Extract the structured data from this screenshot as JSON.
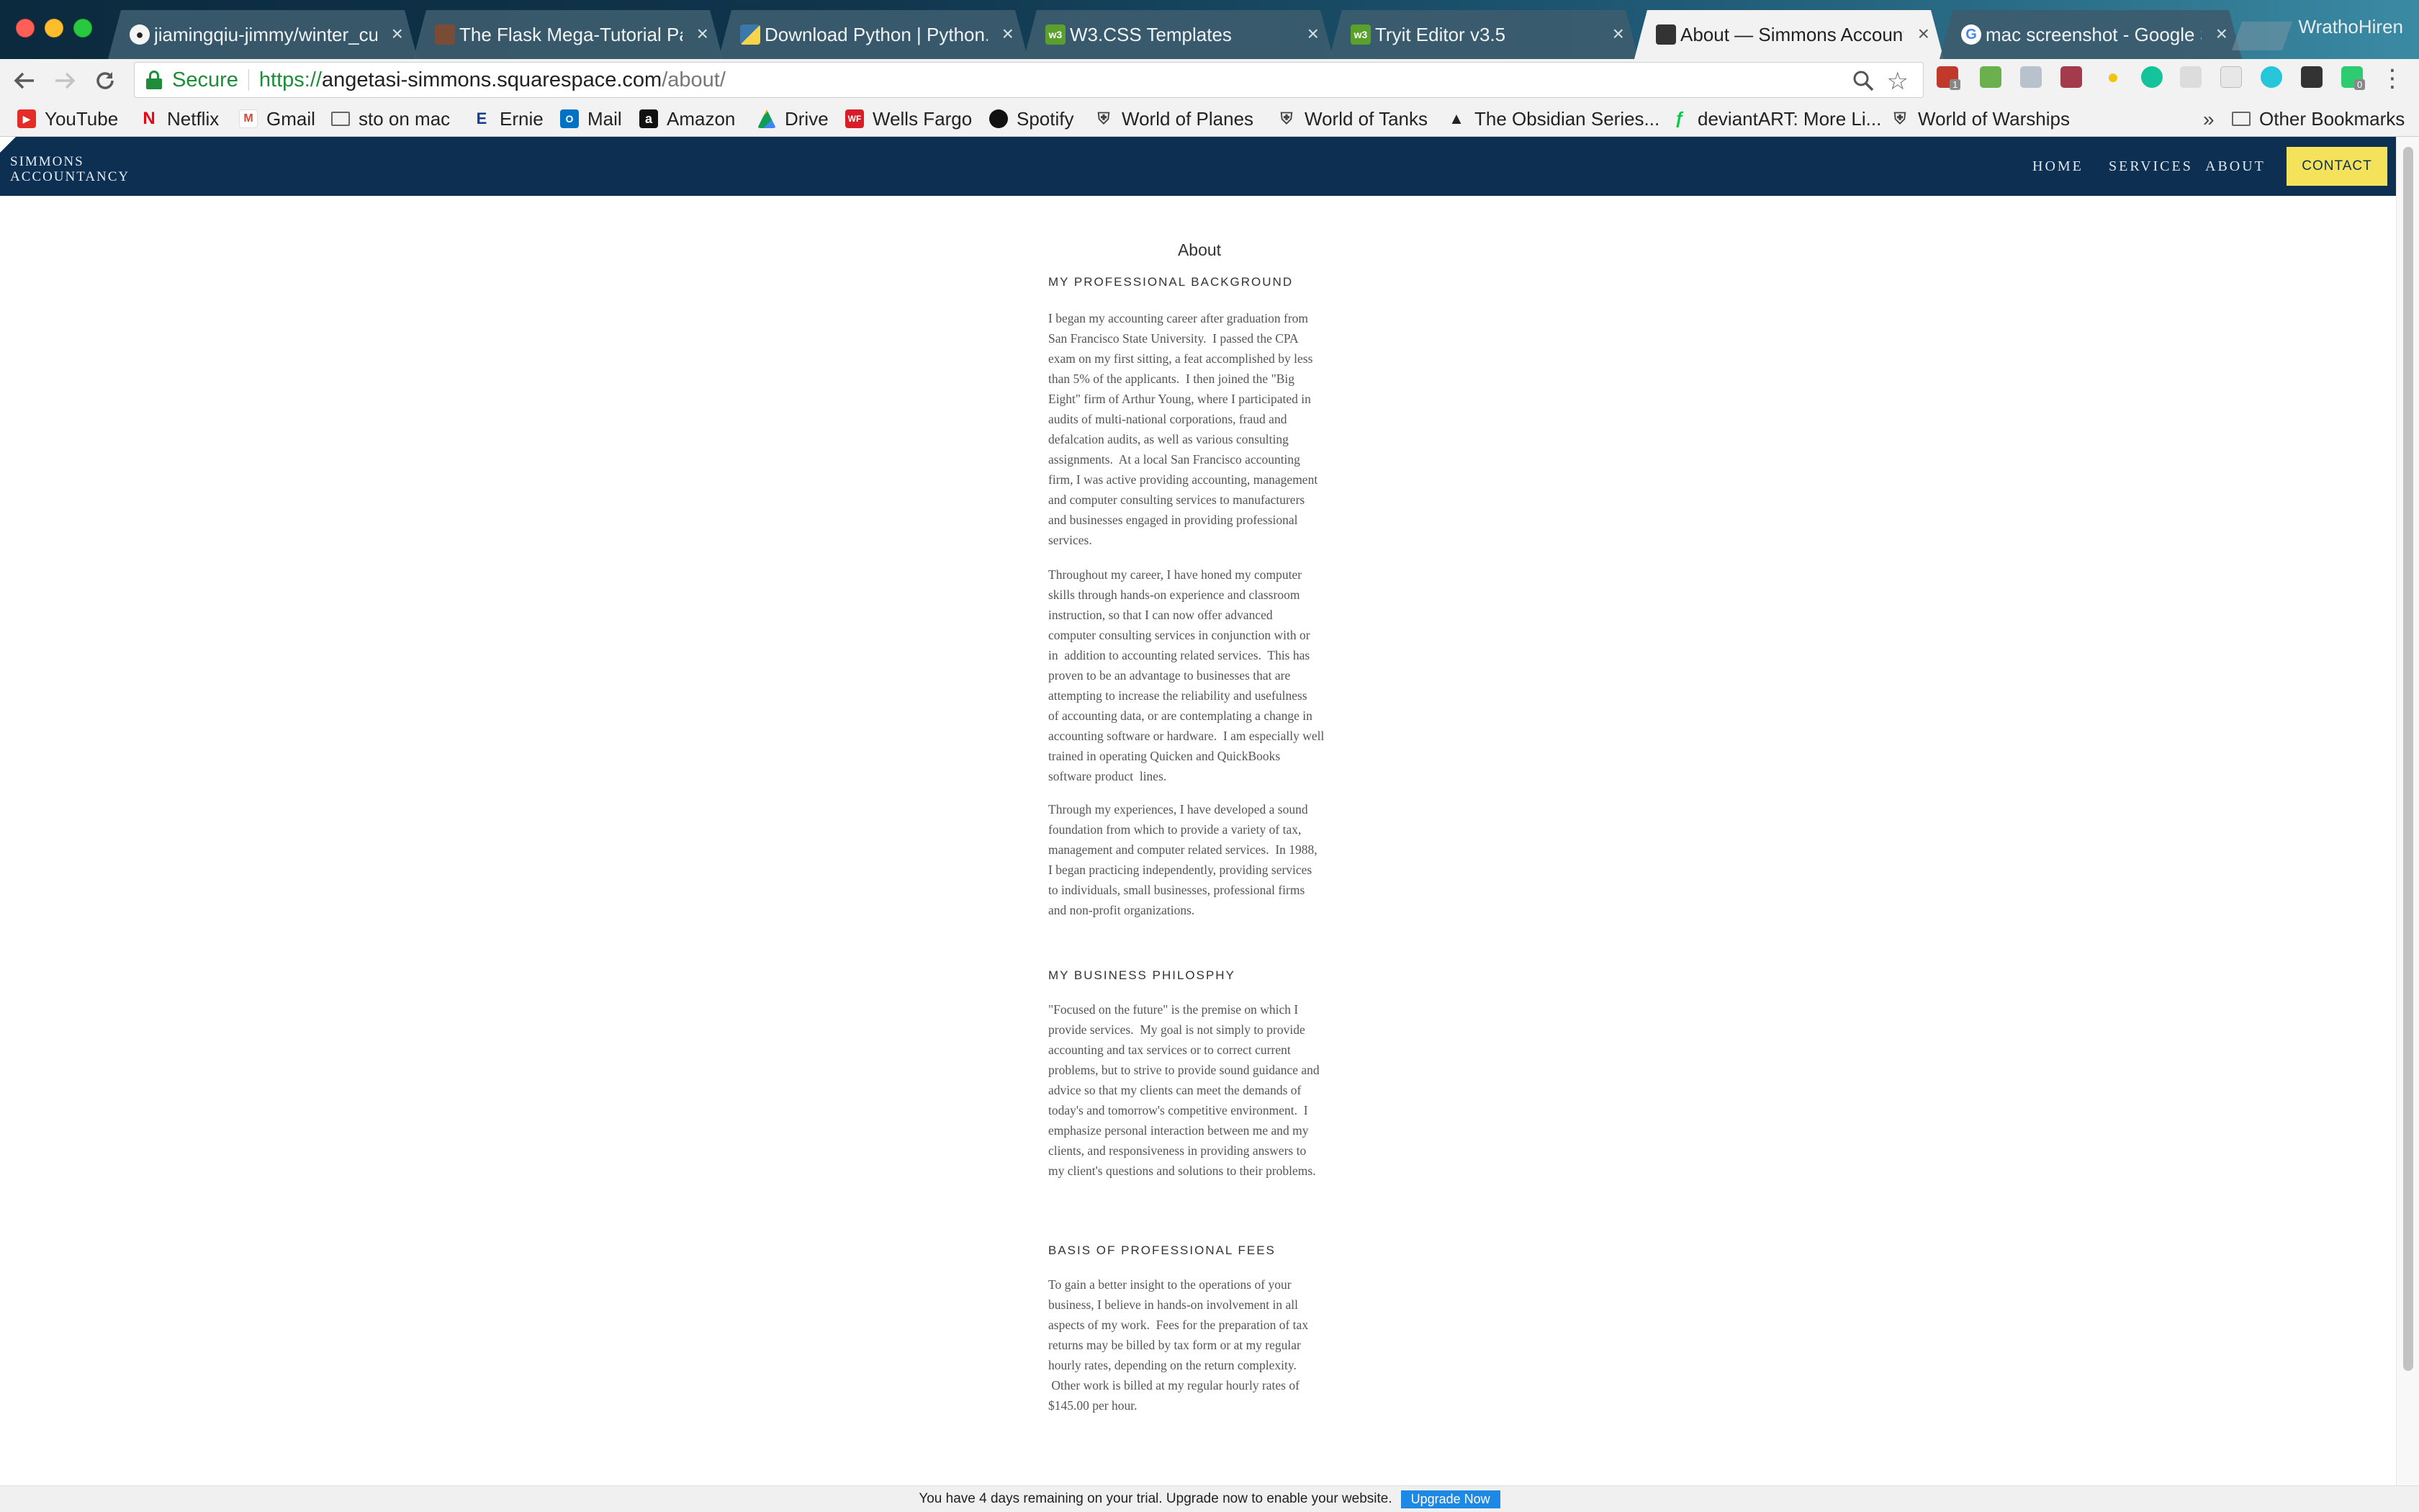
{
  "browser": {
    "tabs": [
      {
        "title": "jiamingqiu-jimmy/winter_cu",
        "favicon": "github-icon",
        "active": false
      },
      {
        "title": "The Flask Mega-Tutorial Pa",
        "favicon": "avatar-photo-icon",
        "active": false
      },
      {
        "title": "Download Python | Python.",
        "favicon": "python-logo-icon",
        "active": false
      },
      {
        "title": "W3.CSS Templates",
        "favicon": "w3schools-icon",
        "active": false
      },
      {
        "title": "Tryit Editor v3.5",
        "favicon": "w3schools-icon",
        "active": false
      },
      {
        "title": "About — Simmons Account",
        "favicon": "squarespace-cube-icon",
        "active": true
      },
      {
        "title": "mac screenshot - Google S",
        "favicon": "google-g-icon",
        "active": false
      }
    ],
    "tab_close_glyph": "×",
    "profile_name": "WrathoHiren",
    "secure_label": "Secure",
    "url": {
      "scheme": "https://",
      "host": "angetasi-simmons.squarespace.com",
      "path": "/about/"
    },
    "extension_badges": {
      "first": "1",
      "last": "0"
    },
    "bookmarks": [
      {
        "label": "YouTube",
        "icon": "youtube-icon"
      },
      {
        "label": "Netflix",
        "icon": "netflix-icon"
      },
      {
        "label": "Gmail",
        "icon": "gmail-icon"
      },
      {
        "label": "sto on mac",
        "icon": "folder-icon"
      },
      {
        "label": "Ernie",
        "icon": "e-logo-icon"
      },
      {
        "label": "Mail",
        "icon": "outlook-icon"
      },
      {
        "label": "Amazon",
        "icon": "amazon-icon"
      },
      {
        "label": "Drive",
        "icon": "google-drive-icon"
      },
      {
        "label": "Wells Fargo",
        "icon": "wells-fargo-icon"
      },
      {
        "label": "Spotify",
        "icon": "spotify-icon"
      },
      {
        "label": "World of Planes",
        "icon": "wargaming-icon"
      },
      {
        "label": "World of Tanks",
        "icon": "wargaming-icon"
      },
      {
        "label": "The Obsidian Series...",
        "icon": "dragon-icon"
      },
      {
        "label": "deviantART: More Li...",
        "icon": "deviantart-icon"
      },
      {
        "label": "World of Warships",
        "icon": "wargaming-icon"
      }
    ],
    "bookmarks_overflow": "»",
    "other_bookmarks": "Other Bookmarks"
  },
  "site": {
    "logo_line1": "SIMMONS",
    "logo_line2": "ACCOUNTANCY",
    "nav": {
      "home": "HOME",
      "services": "SERVICES",
      "about": "ABOUT",
      "contact": "CONTACT"
    },
    "page_title": "About",
    "sections": [
      {
        "heading": "MY PROFESSIONAL BACKGROUND",
        "paragraphs": [
          [
            "I began my accounting career after graduation from",
            "San Francisco State University.  I passed the CPA",
            "exam on my first sitting, a feat accomplished by less",
            "than 5% of the applicants.  I then joined the \"Big",
            "Eight\" firm of Arthur Young, where I participated in",
            "audits of multi-national corporations, fraud and",
            "defalcation audits, as well as various consulting",
            "assignments.  At a local San Francisco accounting",
            "firm, I was active providing accounting, management",
            "and computer consulting services to manufacturers",
            "and businesses engaged in providing professional",
            "services."
          ],
          [
            "Throughout my career, I have honed my computer",
            "skills through hands-on experience and classroom",
            "instruction, so that I can now offer advanced",
            "computer consulting services in conjunction with or",
            "in  addition to accounting related services.  This has",
            "proven to be an advantage to businesses that are",
            "attempting to increase the reliability and usefulness",
            "of accounting data, or are contemplating a change in",
            "accounting software or hardware.  I am especially well",
            "trained in operating Quicken and QuickBooks",
            "software product  lines."
          ],
          [
            "Through my experiences, I have developed a sound",
            "foundation from which to provide a variety of tax,",
            "management and computer related services.  In 1988,",
            "I began practicing independently, providing services",
            "to individuals, small businesses, professional firms",
            "and non-profit organizations."
          ]
        ]
      },
      {
        "heading": "MY BUSINESS PHILOSPHY",
        "paragraphs": [
          [
            "\"Focused on the future\" is the premise on which I",
            "provide services.  My goal is not simply to provide",
            "accounting and tax services or to correct current",
            "problems, but to strive to provide sound guidance and",
            "advice so that my clients can meet the demands of",
            "today's and tomorrow's competitive environment.  I",
            "emphasize personal interaction between me and my",
            "clients, and responsiveness in providing answers to",
            "my client's questions and solutions to their problems."
          ]
        ]
      },
      {
        "heading": "BASIS OF PROFESSIONAL FEES",
        "paragraphs": [
          [
            "To gain a better insight to the operations of your",
            "business, I believe in hands-on involvement in all",
            "aspects of my work.  Fees for the preparation of tax",
            "returns may be billed by tax form or at my regular",
            "hourly rates, depending on the return complexity.",
            " Other work is billed at my regular hourly rates of",
            "$145.00 per hour."
          ]
        ]
      }
    ],
    "trial_message": "You have 4 days remaining on your trial. Upgrade now to enable your website.",
    "upgrade_label": "Upgrade Now"
  },
  "colors": {
    "header_bg": "#0c2f52",
    "contact_bg": "#f4e35a",
    "secure_green": "#1f8c3a",
    "upgrade_blue": "#1e88e5"
  }
}
